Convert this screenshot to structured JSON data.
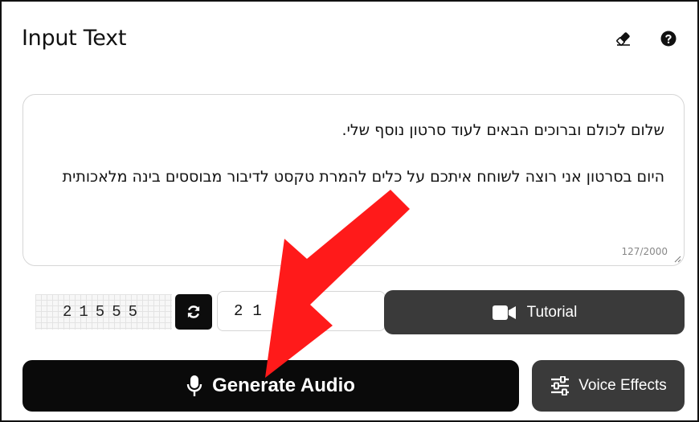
{
  "header": {
    "title": "Input Text",
    "eraser_icon": "eraser-icon",
    "help_icon": "question-circle-icon"
  },
  "text_input": {
    "lines": [
      "שלום לכולם וברוכים הבאים לעוד סרטון נוסף שלי.",
      "היום בסרטון אני רוצה לשוחח איתכם על כלים להמרת טקסט לדיבור מבוססים בינה מלאכותית"
    ],
    "char_count": "127/2000"
  },
  "captcha": {
    "code": "21555",
    "refresh_icon": "refresh-icon",
    "input_value": "21"
  },
  "buttons": {
    "tutorial_label": "Tutorial",
    "tutorial_icon": "video-camera-icon",
    "generate_label": "Generate Audio",
    "generate_icon": "microphone-icon",
    "voice_effects_label": "Voice Effects",
    "voice_effects_icon": "sliders-icon"
  },
  "colors": {
    "annotation_arrow": "#ff0000",
    "primary_button": "#0a0a0a",
    "secondary_button": "#3a3a3a"
  }
}
